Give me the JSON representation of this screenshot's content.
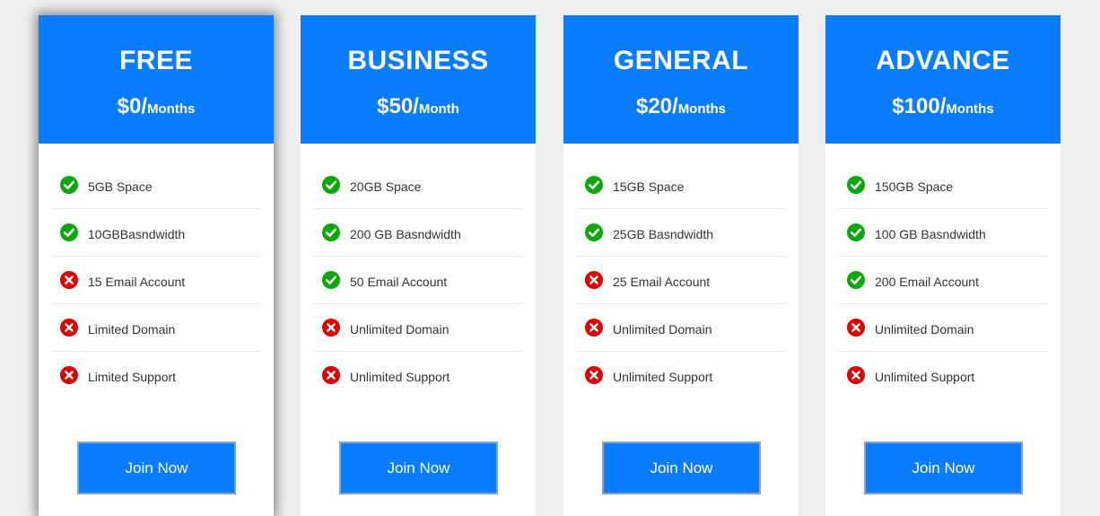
{
  "colors": {
    "header_bg": "#0a7cff",
    "button_bg": "#0a7cff",
    "check": "#0aa80a",
    "cross": "#e00000",
    "page_bg": "#efefef"
  },
  "plans": [
    {
      "name": "FREE",
      "price": "$0/",
      "period": "Months",
      "featured": true,
      "button": "Join Now",
      "features": [
        {
          "text": "5GB Space",
          "icon": "check-icon"
        },
        {
          "text": "10GBBasndwidth",
          "icon": "check-icon"
        },
        {
          "text": "15 Email Account",
          "icon": "cross-icon"
        },
        {
          "text": "Limited Domain",
          "icon": "cross-icon"
        },
        {
          "text": "Limited Support",
          "icon": "cross-icon"
        }
      ]
    },
    {
      "name": "BUSINESS",
      "price": "$50/",
      "period": "Month",
      "featured": false,
      "button": "Join Now",
      "features": [
        {
          "text": "20GB Space",
          "icon": "check-icon"
        },
        {
          "text": "200 GB Basndwidth",
          "icon": "check-icon"
        },
        {
          "text": "50 Email Account",
          "icon": "check-icon"
        },
        {
          "text": "Unlimited Domain",
          "icon": "cross-icon"
        },
        {
          "text": "Unlimited Support",
          "icon": "cross-icon"
        }
      ]
    },
    {
      "name": "GENERAL",
      "price": "$20/",
      "period": "Months",
      "featured": false,
      "button": "Join Now",
      "features": [
        {
          "text": "15GB Space",
          "icon": "check-icon"
        },
        {
          "text": "25GB Basndwidth",
          "icon": "check-icon"
        },
        {
          "text": "25 Email Account",
          "icon": "cross-icon"
        },
        {
          "text": "Unlimited Domain",
          "icon": "cross-icon"
        },
        {
          "text": "Unlimited Support",
          "icon": "cross-icon"
        }
      ]
    },
    {
      "name": "ADVANCE",
      "price": "$100/",
      "period": "Months",
      "featured": false,
      "button": "Join Now",
      "features": [
        {
          "text": "150GB Space",
          "icon": "check-icon"
        },
        {
          "text": "100 GB Basndwidth",
          "icon": "check-icon"
        },
        {
          "text": "200 Email Account",
          "icon": "check-icon"
        },
        {
          "text": "Unlimited Domain",
          "icon": "cross-icon"
        },
        {
          "text": "Unlimited Support",
          "icon": "cross-icon"
        }
      ]
    }
  ]
}
